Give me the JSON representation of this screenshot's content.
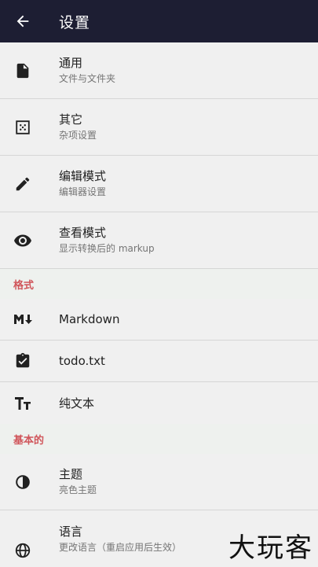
{
  "appbar": {
    "title": "设置"
  },
  "items_top": [
    {
      "icon": "file-icon",
      "title": "通用",
      "subtitle": "文件与文件夹"
    },
    {
      "icon": "dots-grid-icon",
      "title": "其它",
      "subtitle": "杂项设置"
    },
    {
      "icon": "pencil-icon",
      "title": "编辑模式",
      "subtitle": "编辑器设置"
    },
    {
      "icon": "eye-icon",
      "title": "查看模式",
      "subtitle": "显示转换后的 markup"
    }
  ],
  "section_formats": "格式",
  "formats": [
    {
      "icon": "markdown-icon",
      "title": "Markdown"
    },
    {
      "icon": "clipboard-check-icon",
      "title": "todo.txt"
    },
    {
      "icon": "text-format-icon",
      "title": "纯文本"
    }
  ],
  "section_basic": "基本的",
  "basic": [
    {
      "icon": "contrast-icon",
      "title": "主题",
      "subtitle": "亮色主题"
    },
    {
      "icon": "globe-icon",
      "title": "语言",
      "subtitle": "更改语言（重启应用后生效）"
    }
  ],
  "watermark": "大玩客"
}
